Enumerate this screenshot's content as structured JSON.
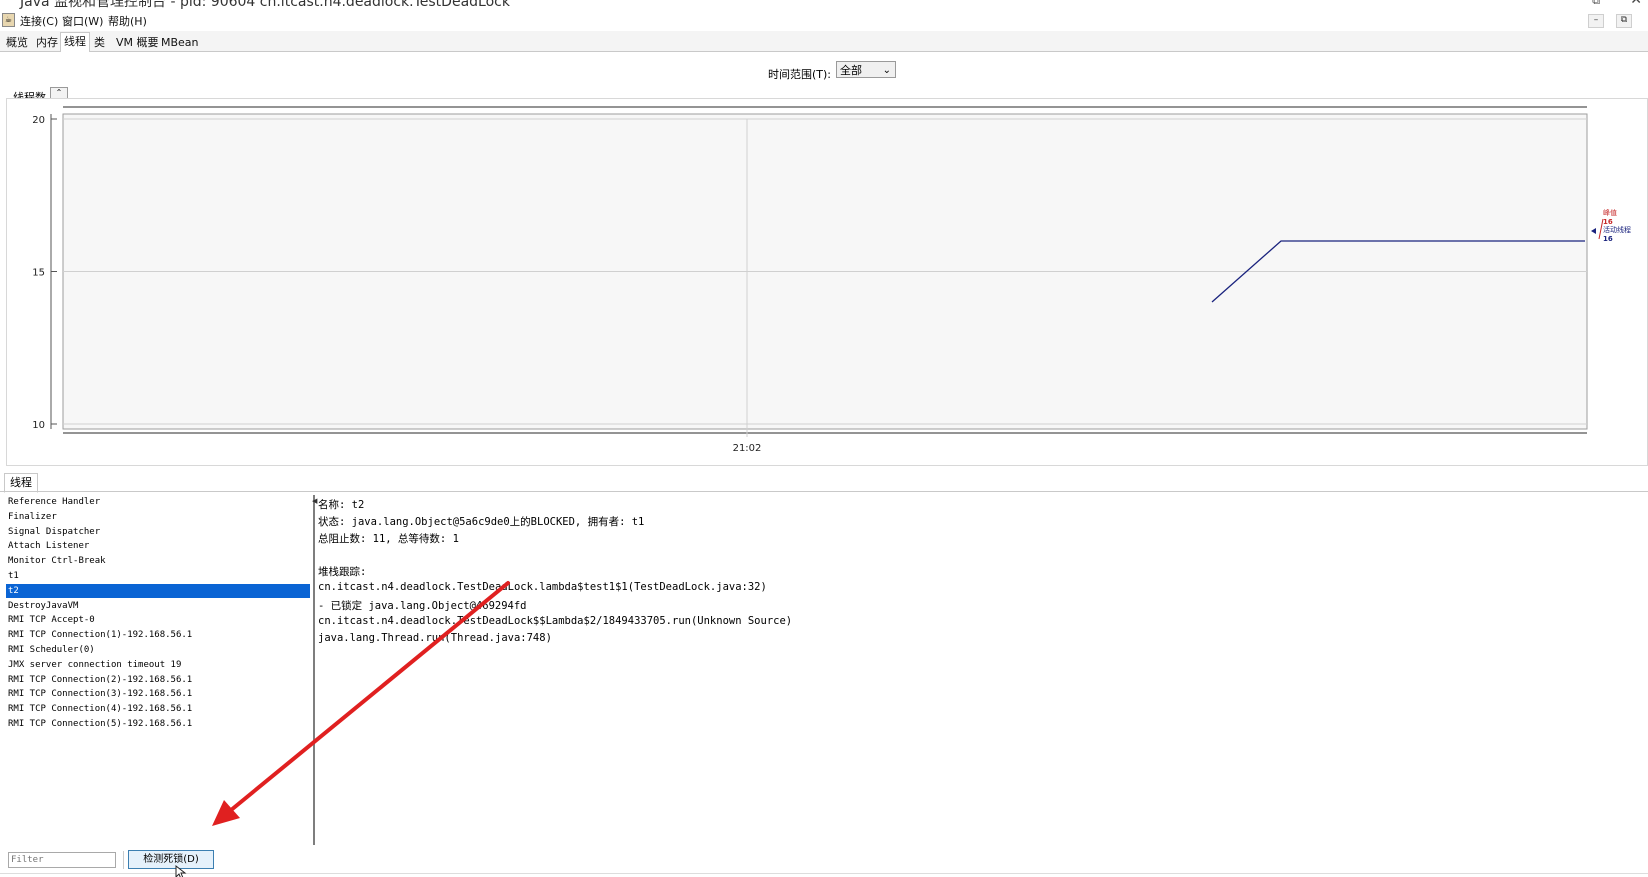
{
  "window": {
    "title": "Java 监视和管理控制台 - pid: 90604 cn.itcast.n4.deadlock.TestDeadLock",
    "close_glyph": "✕",
    "restore_glyph": "⧉"
  },
  "menu": {
    "items": [
      "连接(C)",
      "窗口(W)",
      "帮助(H)"
    ],
    "minimize_glyph": "–",
    "restore_glyph": "⧉",
    "close_glyph": "✕"
  },
  "tabs": [
    "概览",
    "内存",
    "线程",
    "类",
    "VM 概要",
    "MBean"
  ],
  "selected_tab": "线程",
  "time_range": {
    "label": "时间范围(T):",
    "value": "全部"
  },
  "threads_panel": {
    "label": "线程数",
    "collapse_glyph": "⌃"
  },
  "chart_data": {
    "type": "line",
    "ylim": [
      10,
      20
    ],
    "yticks": [
      "20",
      "15",
      "10"
    ],
    "xticks": [
      "21:02"
    ],
    "series": [
      {
        "name": "峰值",
        "value_label": "16",
        "color": "#c62828",
        "values": [
          16
        ]
      },
      {
        "name": "活动线程",
        "value_label": "16",
        "color": "#1a237e",
        "x": [
          0.0,
          0.045,
          0.2
        ],
        "values": [
          14,
          16,
          16
        ]
      }
    ]
  },
  "lower_tab": "线程",
  "thread_list": [
    "Reference Handler",
    "Finalizer",
    "Signal Dispatcher",
    "Attach Listener",
    "Monitor Ctrl-Break",
    "t1",
    "t2",
    "DestroyJavaVM",
    "RMI TCP Accept-0",
    "RMI TCP Connection(1)-192.168.56.1",
    "RMI Scheduler(0)",
    "JMX server connection timeout 19",
    "RMI TCP Connection(2)-192.168.56.1",
    "RMI TCP Connection(3)-192.168.56.1",
    "RMI TCP Connection(4)-192.168.56.1",
    "RMI TCP Connection(5)-192.168.56.1"
  ],
  "selected_thread": "t2",
  "detail": {
    "name_line": "名称: t2",
    "state_line": "状态: java.lang.Object@5a6c9de0上的BLOCKED, 拥有者: t1",
    "counts_line": "总阻止数: 11, 总等待数: 1",
    "stack_header": "堆栈跟踪:",
    "stack": [
      "cn.itcast.n4.deadlock.TestDeadLock.lambda$test1$1(TestDeadLock.java:32)",
      "   - 已锁定 java.lang.Object@469294fd",
      "cn.itcast.n4.deadlock.TestDeadLock$$Lambda$2/1849433705.run(Unknown Source)",
      "java.lang.Thread.run(Thread.java:748)"
    ]
  },
  "filter": {
    "placeholder": "Filter"
  },
  "deadlock_button": "检测死锁(D)",
  "colors": {
    "annotation_arrow": "#e02020",
    "selection": "#0a64d4",
    "chart_line": "#1a237e",
    "peak": "#c62828"
  }
}
